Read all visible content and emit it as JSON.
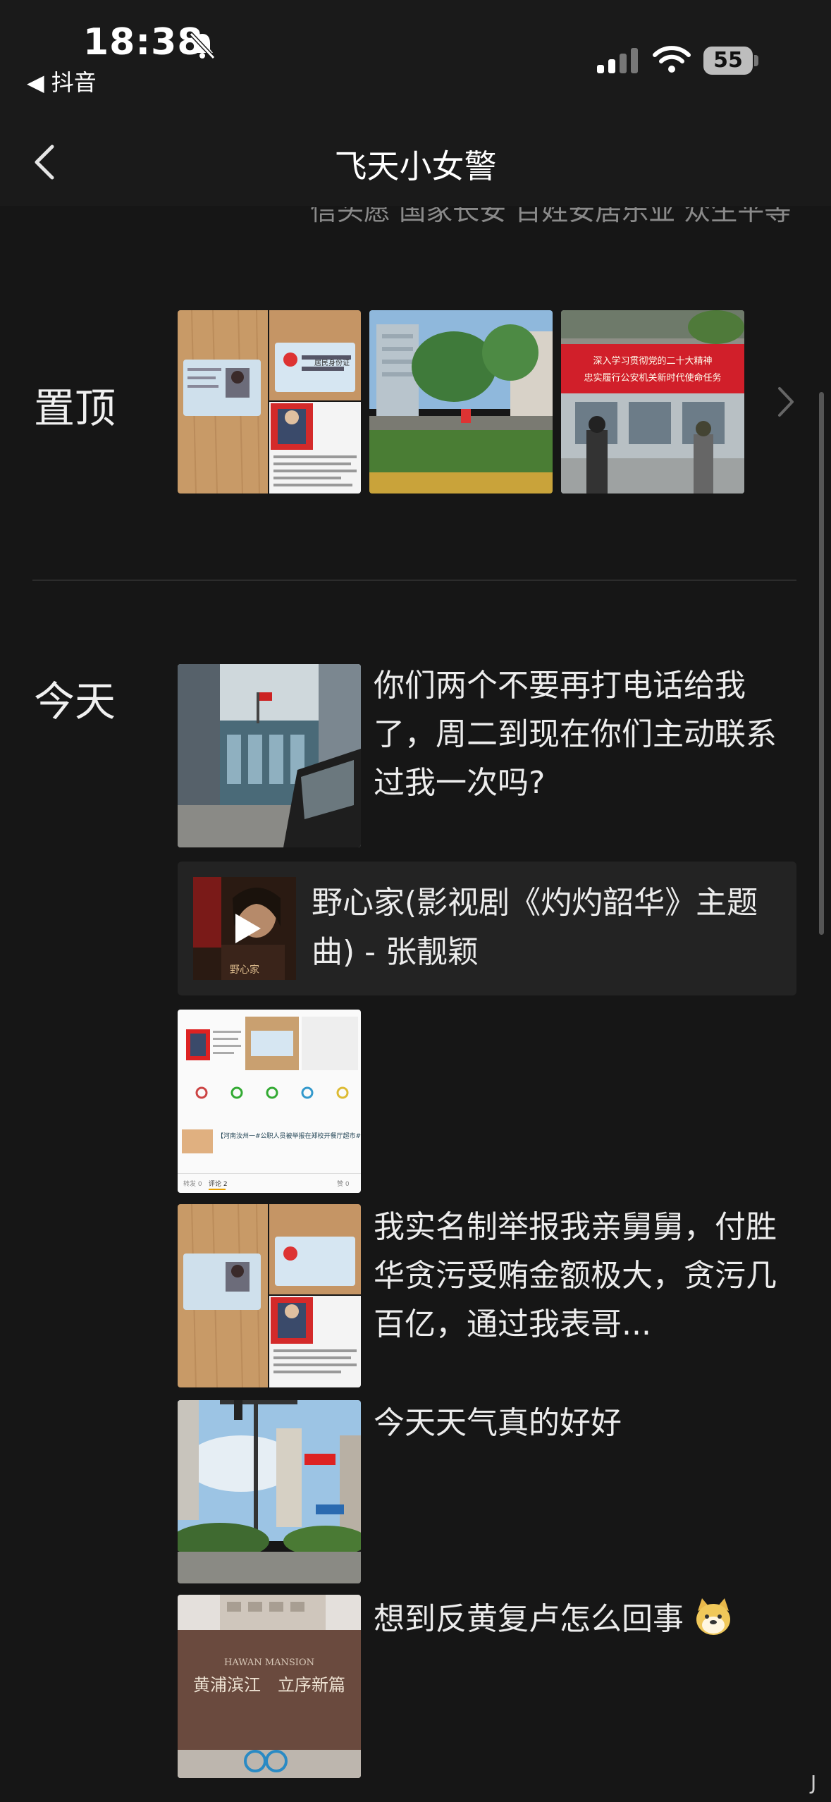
{
  "status_bar": {
    "time": "18:38",
    "back_app": "◀ 抖音",
    "battery": "55"
  },
  "nav": {
    "title": "飞天小女警"
  },
  "partial_text": "信头愿 国家长安 百姓安居乐业 众生平等",
  "sections": {
    "pinned": "置顶",
    "today": "今天"
  },
  "posts": [
    {
      "text": "你们两个不要再打电话给我了，周二到现在你们主动联系过我一次吗?"
    },
    {
      "text": "我实名制举报我亲舅舅，付胜华贪污受贿金额极大，贪污几百亿，通过我表哥..."
    },
    {
      "text": "今天天气真的好好"
    },
    {
      "text": "想到反黄复卢怎么回事"
    }
  ],
  "music": {
    "title": "野心家(影视剧《灼灼韶华》主题曲) - 张靓颖"
  },
  "thumb_texts": {
    "banner_line1": "深入学习贯彻党的二十大精神",
    "banner_line2": "忠实履行公安机关新时代使命任务",
    "id_card": "居民身份证",
    "news_caption": "【河南汝州一#公职人员被举报在郑校开餐厅超市#，本人回应称“是他别人帮忙”】#公...",
    "news_likes": "转发 0",
    "news_comments": "评论 2",
    "news_zero": "赞 0",
    "mansion_line1": "黄浦滨江",
    "mansion_line2": "立序新篇",
    "mansion_en": "HAWAN MANSION"
  },
  "watermark": "J"
}
